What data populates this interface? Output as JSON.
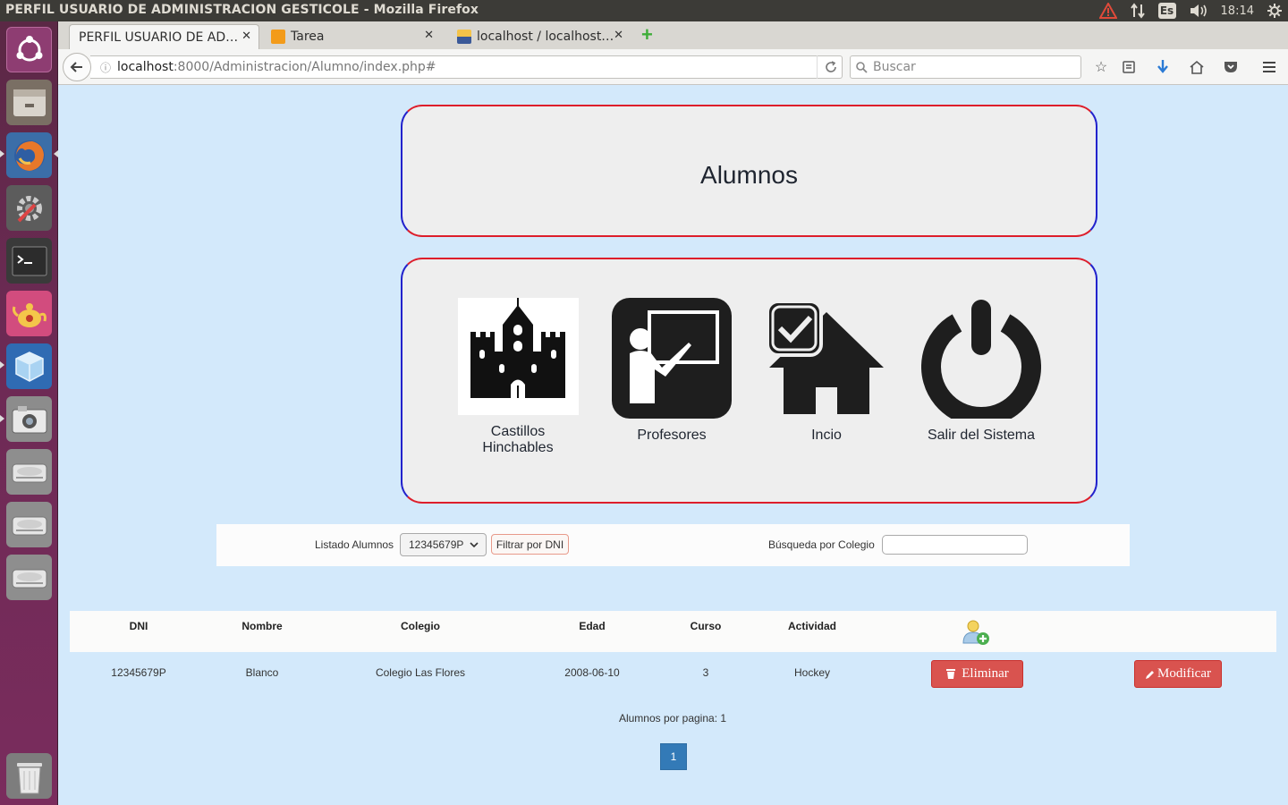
{
  "system": {
    "window_title": "PERFIL USUARIO DE ADMINISTRACION GESTICOLE - Mozilla Firefox",
    "keyboard_layout": "Es",
    "clock": "18:14"
  },
  "browser": {
    "tabs": [
      {
        "label": "PERFIL USUARIO DE AD…",
        "active": true
      },
      {
        "label": "Tarea",
        "active": false
      },
      {
        "label": "localhost / localhost…",
        "active": false
      }
    ],
    "url_host": "localhost",
    "url_path": ":8000/Administracion/Alumno/index.php#",
    "search_placeholder": "Buscar"
  },
  "page": {
    "title": "Alumnos",
    "menu": [
      {
        "label_line1": "Castillos",
        "label_line2": "Hinchables",
        "icon": "castle-icon"
      },
      {
        "label": "Profesores",
        "icon": "teacher-icon"
      },
      {
        "label": "Incio",
        "icon": "home-check-icon"
      },
      {
        "label": "Salir del Sistema",
        "icon": "power-icon"
      }
    ],
    "filter": {
      "listado_label": "Listado Alumnos",
      "selected_dni": "12345679P",
      "filter_button": "Filtrar por DNI",
      "search_label": "Búsqueda por Colegio",
      "search_value": ""
    },
    "table": {
      "headers": [
        "DNI",
        "Nombre",
        "Colegio",
        "Edad",
        "Curso",
        "Actividad"
      ],
      "rows": [
        {
          "dni": "12345679P",
          "nombre": "Blanco",
          "colegio": "Colegio Las Flores",
          "edad": "2008-06-10",
          "curso": "3",
          "actividad": "Hockey"
        }
      ],
      "delete_label": "Eliminar",
      "modify_label": "Modificar"
    },
    "per_page": "Alumnos por pagina: 1",
    "current_page": "1"
  },
  "colors": {
    "page_background": "#d3e9fb",
    "card_border_red": "#dd1e2b",
    "card_border_blue": "#2222cc",
    "danger": "#d9534f",
    "primary": "#337ab7"
  }
}
